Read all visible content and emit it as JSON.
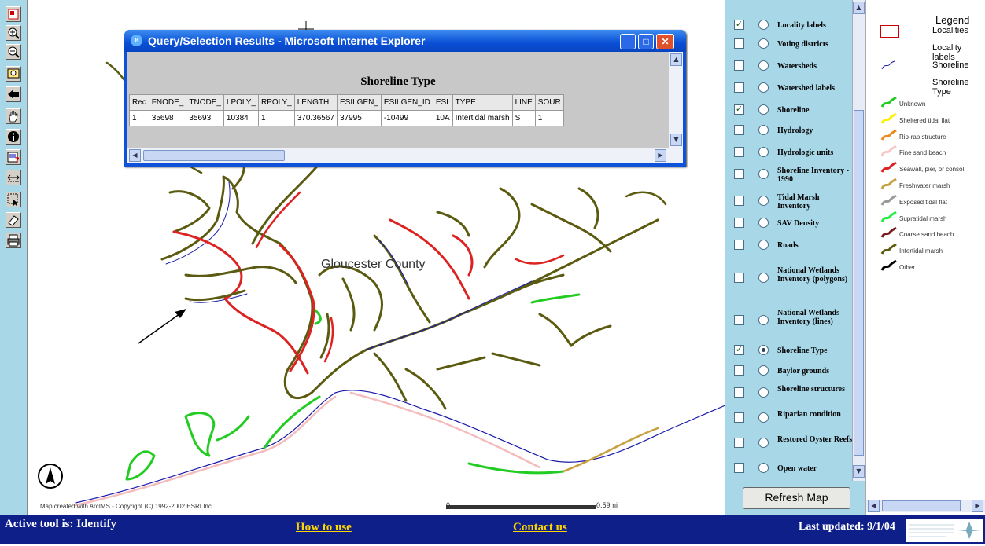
{
  "toolbar": {
    "tools": [
      {
        "name": "toggle-overview-tool",
        "icon": "overview-icon"
      },
      {
        "name": "zoom-in-tool",
        "icon": "zoom-in-icon"
      },
      {
        "name": "zoom-out-tool",
        "icon": "zoom-out-icon"
      },
      {
        "name": "full-extent-tool",
        "icon": "full-extent-icon"
      },
      {
        "name": "back-tool",
        "icon": "back-arrow-icon"
      },
      {
        "name": "pan-tool",
        "icon": "hand-icon"
      },
      {
        "name": "identify-tool",
        "icon": "info-icon"
      },
      {
        "name": "query-tool",
        "icon": "query-icon"
      },
      {
        "name": "measure-tool",
        "icon": "measure-icon"
      },
      {
        "name": "select-tool",
        "icon": "select-rect-icon"
      },
      {
        "name": "clear-selection-tool",
        "icon": "eraser-icon"
      },
      {
        "name": "print-tool",
        "icon": "printer-icon"
      }
    ]
  },
  "map": {
    "county_label": "Gloucester County",
    "copyright": "Map created with ArcIMS - Copyright (C) 1992-2002 ESRI Inc.",
    "scale_zero": "0",
    "scale_distance": "0.59mi",
    "north_arrow_icon": "north-arrow-icon"
  },
  "popup": {
    "window_title": "Query/Selection Results - Microsoft Internet Explorer",
    "heading": "Shoreline Type",
    "columns": [
      "Rec",
      "FNODE_",
      "TNODE_",
      "LPOLY_",
      "RPOLY_",
      "LENGTH",
      "ESILGEN_",
      "ESILGEN_ID",
      "ESI",
      "TYPE",
      "LINE",
      "SOUR"
    ],
    "rows": [
      [
        "1",
        "35698",
        "35693",
        "10384",
        "1",
        "370.36567",
        "37995",
        "-10499",
        "10A",
        "Intertidal marsh",
        "S",
        "1"
      ]
    ]
  },
  "layers": [
    {
      "label": "Locality labels",
      "checked": true,
      "active": false
    },
    {
      "label": "Voting districts",
      "checked": false,
      "active": false
    },
    {
      "label": "Watersheds",
      "checked": false,
      "active": false
    },
    {
      "label": "Watershed labels",
      "checked": false,
      "active": false
    },
    {
      "label": "Shoreline",
      "checked": true,
      "active": false
    },
    {
      "label": "Hydrology",
      "checked": false,
      "active": false
    },
    {
      "label": "Hydrologic units",
      "checked": false,
      "active": false
    },
    {
      "label": "Shoreline Inventory - 1990",
      "checked": false,
      "active": false
    },
    {
      "label": "Tidal Marsh Inventory",
      "checked": false,
      "active": false
    },
    {
      "label": "SAV Density",
      "checked": false,
      "active": false
    },
    {
      "label": "Roads",
      "checked": false,
      "active": false
    },
    {
      "label": "National Wetlands Inventory (polygons)",
      "checked": false,
      "active": false
    },
    {
      "label": "National Wetlands Inventory (lines)",
      "checked": false,
      "active": false
    },
    {
      "label": "Shoreline Type",
      "checked": true,
      "active": true
    },
    {
      "label": "Baylor grounds",
      "checked": false,
      "active": false
    },
    {
      "label": "Shoreline structures",
      "checked": false,
      "active": false
    },
    {
      "label": "Riparian condition",
      "checked": false,
      "active": false
    },
    {
      "label": "Restored Oyster Reefs",
      "checked": false,
      "active": false
    },
    {
      "label": "Open water",
      "checked": false,
      "active": false
    }
  ],
  "refresh_button": "Refresh Map",
  "legend": {
    "title": "Legend",
    "localities": "Localities",
    "locality_labels": "Locality labels",
    "shoreline": "Shoreline",
    "shoreline_type": "Shoreline Type",
    "types": [
      {
        "label": "Unknown",
        "color": "#22cc22"
      },
      {
        "label": "Sheltered tidal flat",
        "color": "#ffee00"
      },
      {
        "label": "Rip-rap structure",
        "color": "#ee8a1a"
      },
      {
        "label": "Fine sand beach",
        "color": "#f8c8c8"
      },
      {
        "label": "Seawall, pier, or consol",
        "color": "#dd2222"
      },
      {
        "label": "Freshwater marsh",
        "color": "#c8a040"
      },
      {
        "label": "Exposed tidal flat",
        "color": "#999999"
      },
      {
        "label": "Supratidal marsh",
        "color": "#22ee44"
      },
      {
        "label": "Coarse sand beach",
        "color": "#7a1a1a"
      },
      {
        "label": "Intertidal marsh",
        "color": "#5a5a10"
      },
      {
        "label": "Other",
        "color": "#000000"
      }
    ]
  },
  "status": {
    "active_tool": "Active tool is: Identify",
    "how_to_use": "How to use",
    "contact_us": "Contact us",
    "last_updated": "Last updated: 9/1/04"
  },
  "colors": {
    "panel": "#a8d8e8",
    "statusbar": "#0f1f8a",
    "link": "#ffd700",
    "marsh": "#5a5a10",
    "seawall": "#dd2222",
    "shoreline": "#1a1aaa",
    "supratidal": "#22cc22"
  }
}
